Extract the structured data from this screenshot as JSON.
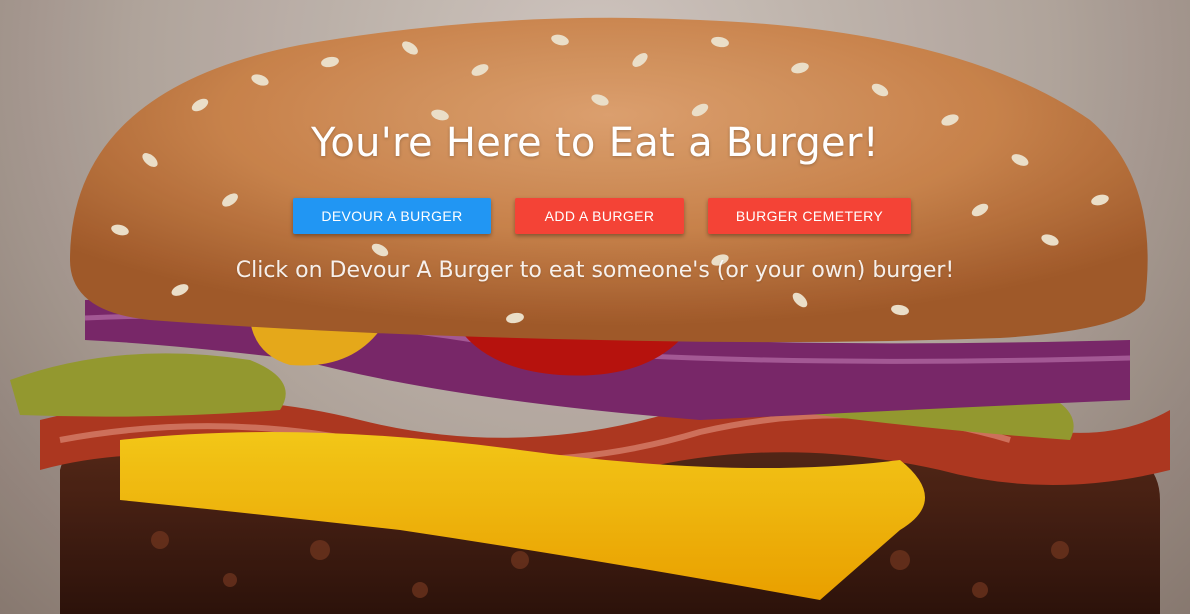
{
  "hero": {
    "title": "You're Here to Eat a Burger!",
    "subtitle": "Click on Devour A Burger to eat someone's (or your own) burger!",
    "background_image": "burger-photo"
  },
  "buttons": {
    "devour_label": "DEVOUR A BURGER",
    "add_label": "ADD A BURGER",
    "cemetery_label": "BURGER CEMETERY"
  },
  "colors": {
    "devour_button": "#2196f3",
    "add_button": "#f44336",
    "cemetery_button": "#f44336"
  }
}
